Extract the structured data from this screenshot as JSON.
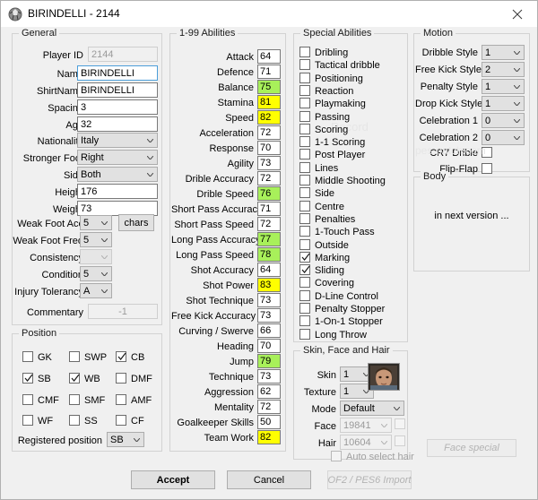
{
  "window": {
    "title": "BIRINDELLI - 2144",
    "icon": "app-ball-icon",
    "close_label": "close-icon"
  },
  "watermarks": {
    "record": "Record",
    "pespatch": "pes-patch.com"
  },
  "general": {
    "legend": "General",
    "fields": [
      {
        "label": "Player ID",
        "value": "2144",
        "type": "readonly-text"
      },
      {
        "label": "Name",
        "value": "BIRINDELLI",
        "type": "text-focused"
      },
      {
        "label": "ShirtName",
        "value": "BIRINDELLI",
        "type": "text"
      },
      {
        "label": "Spacing",
        "value": "3",
        "type": "text"
      },
      {
        "label": "Age",
        "value": "32",
        "type": "text"
      },
      {
        "label": "Nationality",
        "value": "Italy",
        "type": "combo"
      },
      {
        "label": "Stronger Foot",
        "value": "Right",
        "type": "combo"
      },
      {
        "label": "Side",
        "value": "Both",
        "type": "combo"
      },
      {
        "label": "Height",
        "value": "176",
        "type": "text"
      },
      {
        "label": "Weight",
        "value": "73",
        "type": "text"
      }
    ],
    "weak_foot_acc": {
      "label": "Weak Foot Acc",
      "value": "5"
    },
    "weak_foot_freq": {
      "label": "Weak Foot Freq",
      "value": "5"
    },
    "consistency": {
      "label": "Consistency",
      "value": ""
    },
    "condition": {
      "label": "Condition",
      "value": "5"
    },
    "injury_tolerancy": {
      "label": "Injury Tolerancy",
      "value": "A"
    },
    "commentary": {
      "label": "Commentary",
      "value": "-1"
    },
    "chars_button": "chars"
  },
  "abilities": {
    "legend": "1-99 Abilities",
    "items": [
      {
        "label": "Attack",
        "value": "64",
        "hl": "none"
      },
      {
        "label": "Defence",
        "value": "71",
        "hl": "none"
      },
      {
        "label": "Balance",
        "value": "75",
        "hl": "green"
      },
      {
        "label": "Stamina",
        "value": "81",
        "hl": "yellow"
      },
      {
        "label": "Speed",
        "value": "82",
        "hl": "yellow"
      },
      {
        "label": "Acceleration",
        "value": "72",
        "hl": "none"
      },
      {
        "label": "Response",
        "value": "70",
        "hl": "none"
      },
      {
        "label": "Agility",
        "value": "73",
        "hl": "none"
      },
      {
        "label": "Drible Accuracy",
        "value": "72",
        "hl": "none"
      },
      {
        "label": "Drible Speed",
        "value": "76",
        "hl": "green"
      },
      {
        "label": "Short Pass Accuracy",
        "value": "71",
        "hl": "none"
      },
      {
        "label": "Short Pass Speed",
        "value": "72",
        "hl": "none"
      },
      {
        "label": "Long Pass Accuracy",
        "value": "77",
        "hl": "green"
      },
      {
        "label": "Long Pass Speed",
        "value": "78",
        "hl": "green"
      },
      {
        "label": "Shot Accuracy",
        "value": "64",
        "hl": "none"
      },
      {
        "label": "Shot Power",
        "value": "83",
        "hl": "yellow"
      },
      {
        "label": "Shot Technique",
        "value": "73",
        "hl": "none"
      },
      {
        "label": "Free Kick Accuracy",
        "value": "73",
        "hl": "none"
      },
      {
        "label": "Curving / Swerve",
        "value": "66",
        "hl": "none"
      },
      {
        "label": "Heading",
        "value": "70",
        "hl": "none"
      },
      {
        "label": "Jump",
        "value": "79",
        "hl": "green"
      },
      {
        "label": "Technique",
        "value": "73",
        "hl": "none"
      },
      {
        "label": "Aggression",
        "value": "62",
        "hl": "none"
      },
      {
        "label": "Mentality",
        "value": "72",
        "hl": "none"
      },
      {
        "label": "Goalkeeper Skills",
        "value": "50",
        "hl": "none"
      },
      {
        "label": "Team Work",
        "value": "82",
        "hl": "yellow"
      }
    ]
  },
  "special_abilities": {
    "legend": "Special Abilities",
    "items": [
      {
        "label": "Dribling",
        "checked": false
      },
      {
        "label": "Tactical dribble",
        "checked": false
      },
      {
        "label": "Positioning",
        "checked": false
      },
      {
        "label": "Reaction",
        "checked": false
      },
      {
        "label": "Playmaking",
        "checked": false
      },
      {
        "label": "Passing",
        "checked": false
      },
      {
        "label": "Scoring",
        "checked": false
      },
      {
        "label": "1-1 Scoring",
        "checked": false
      },
      {
        "label": "Post Player",
        "checked": false
      },
      {
        "label": "Lines",
        "checked": false
      },
      {
        "label": "Middle Shooting",
        "checked": false
      },
      {
        "label": "Side",
        "checked": false
      },
      {
        "label": "Centre",
        "checked": false
      },
      {
        "label": "Penalties",
        "checked": false
      },
      {
        "label": "1-Touch Pass",
        "checked": false
      },
      {
        "label": "Outside",
        "checked": false
      },
      {
        "label": "Marking",
        "checked": true
      },
      {
        "label": "Sliding",
        "checked": true
      },
      {
        "label": "Covering",
        "checked": false
      },
      {
        "label": "D-Line Control",
        "checked": false
      },
      {
        "label": "Penalty Stopper",
        "checked": false
      },
      {
        "label": "1-On-1 Stopper",
        "checked": false
      },
      {
        "label": "Long Throw",
        "checked": false
      }
    ]
  },
  "motion": {
    "legend": "Motion",
    "items": [
      {
        "label": "Dribble Style",
        "value": "1"
      },
      {
        "label": "Free Kick Style",
        "value": "2"
      },
      {
        "label": "Penalty Style",
        "value": "1"
      },
      {
        "label": "Drop Kick Style",
        "value": "1"
      },
      {
        "label": "Celebration 1",
        "value": "0"
      },
      {
        "label": "Celebration 2",
        "value": "0"
      }
    ],
    "checkboxes": [
      {
        "label": "CR7 Drible",
        "checked": false
      },
      {
        "label": "Flip-Flap",
        "checked": false
      }
    ]
  },
  "body": {
    "legend": "Body",
    "text": "in next version ..."
  },
  "position": {
    "legend": "Position",
    "items": [
      {
        "label": "GK",
        "checked": false
      },
      {
        "label": "SWP",
        "checked": false
      },
      {
        "label": "CB",
        "checked": true
      },
      {
        "label": "SB",
        "checked": true
      },
      {
        "label": "WB",
        "checked": true
      },
      {
        "label": "DMF",
        "checked": false
      },
      {
        "label": "CMF",
        "checked": false
      },
      {
        "label": "SMF",
        "checked": false
      },
      {
        "label": "AMF",
        "checked": false
      },
      {
        "label": "WF",
        "checked": false
      },
      {
        "label": "SS",
        "checked": false
      },
      {
        "label": "CF",
        "checked": false
      }
    ],
    "registered_label": "Registered position",
    "registered_value": "SB"
  },
  "skin_face_hair": {
    "legend": "Skin, Face and Hair",
    "skin": {
      "label": "Skin",
      "value": "1"
    },
    "texture": {
      "label": "Texture",
      "value": "1"
    },
    "mode": {
      "label": "Mode",
      "value": "Default"
    },
    "face": {
      "label": "Face",
      "value": "19841"
    },
    "hair": {
      "label": "Hair",
      "value": "10604"
    },
    "auto_select_hair": {
      "label": "Auto select hair",
      "checked": false
    },
    "face_special_button": "Face special"
  },
  "footer": {
    "accept": "Accept",
    "cancel": "Cancel",
    "import": "OF2 / PES6 Import"
  },
  "colors": {
    "green_highlight": "#a8f05a",
    "yellow_highlight": "#ffff00",
    "focus_border": "#4c9ed9",
    "window_bg": "#f0f0f0"
  }
}
